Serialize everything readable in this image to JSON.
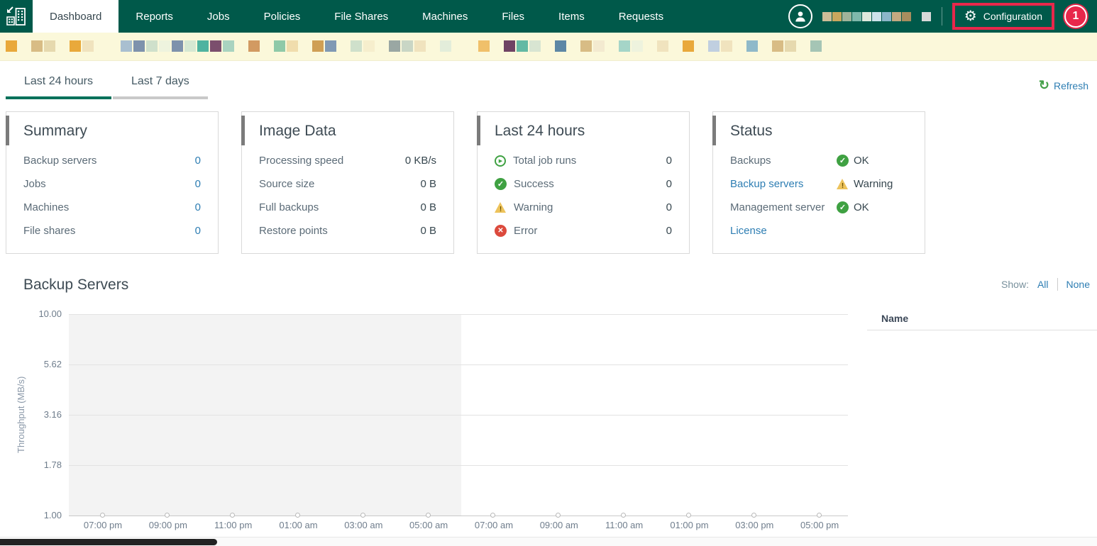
{
  "app": {
    "nav_tabs": [
      {
        "label": "Dashboard",
        "active": true
      },
      {
        "label": "Reports",
        "active": false
      },
      {
        "label": "Jobs",
        "active": false
      },
      {
        "label": "Policies",
        "active": false
      },
      {
        "label": "File Shares",
        "active": false
      },
      {
        "label": "Machines",
        "active": false
      },
      {
        "label": "Files",
        "active": false
      },
      {
        "label": "Items",
        "active": false
      },
      {
        "label": "Requests",
        "active": false
      }
    ],
    "configuration": {
      "label": "Configuration",
      "icon": "gear-icon",
      "highlighted": true
    },
    "notification_badge": "1",
    "user": {
      "icon": "person-avatar-icon",
      "redacted_colors": [
        "#cdbd98",
        "#c9a75e",
        "#9fb39a",
        "#7fb8ab",
        "#dfe8dd",
        "#cde2ea",
        "#8cb6c9",
        "#c3a981",
        "#a78d5e",
        "",
        "#d9d9d9"
      ]
    }
  },
  "redacted_strip": {
    "background": "#fbf8da",
    "squares": [
      "#e9a93b",
      "",
      "#d8bc85",
      "#e6d9ae",
      "",
      "#e9a93b",
      "#f0e3be",
      "",
      "",
      "#a9bfd0",
      "#7e92ac",
      "#cfe0cb",
      "#eef3de",
      "#7e92ac",
      "#d6e8d2",
      "#4fb3a0",
      "#7b4e6d",
      "#a9d3c0",
      "",
      "#d29a62",
      "",
      "#8fc9a8",
      "#f0ddad",
      "",
      "#cf9f55",
      "#8099b4",
      "",
      "#cfe0cb",
      "#f6eecd",
      "",
      "#9aa7a3",
      "#c9d6c5",
      "#f0e3be",
      "",
      "#e3edda",
      "",
      "",
      "#f0c06a",
      "",
      "#6f4364",
      "#63b9a4",
      "#d8e5d2",
      "",
      "#5d87a5",
      "",
      "#d8bc85",
      "#f3ead0",
      "",
      "#a5d5c8",
      "#eef3de",
      "",
      "#f0e3be",
      "",
      "#e9a93b",
      "",
      "#c0cfe0",
      "#f0e3be",
      "",
      "#8fb9c9",
      "",
      "#d8bc85",
      "#e6d9ae",
      "",
      "#a5c5b5"
    ]
  },
  "period_tabs": {
    "tabs": [
      "Last 24 hours",
      "Last 7 days"
    ],
    "active": "Last 24 hours",
    "refresh_label": "Refresh",
    "refresh_icon": "refresh-icon"
  },
  "cards": {
    "summary": {
      "title": "Summary",
      "rows": [
        {
          "label": "Backup servers",
          "value": "0"
        },
        {
          "label": "Jobs",
          "value": "0"
        },
        {
          "label": "Machines",
          "value": "0"
        },
        {
          "label": "File shares",
          "value": "0"
        }
      ]
    },
    "image_data": {
      "title": "Image Data",
      "rows": [
        {
          "label": "Processing speed",
          "value": "0 KB/s"
        },
        {
          "label": "Source size",
          "value": "0 B"
        },
        {
          "label": "Full backups",
          "value": "0 B"
        },
        {
          "label": "Restore points",
          "value": "0 B"
        }
      ]
    },
    "last_24_hours": {
      "title": "Last 24 hours",
      "rows": [
        {
          "icon": "play-circle-icon",
          "label": "Total job runs",
          "value": "0"
        },
        {
          "icon": "success-check-icon",
          "label": "Success",
          "value": "0"
        },
        {
          "icon": "warning-triangle-icon",
          "label": "Warning",
          "value": "0"
        },
        {
          "icon": "error-cross-icon",
          "label": "Error",
          "value": "0"
        }
      ]
    },
    "status": {
      "title": "Status",
      "rows": [
        {
          "label": "Backups",
          "link": false,
          "status_icon": "ok-check-icon",
          "status": "OK"
        },
        {
          "label": "Backup servers",
          "link": true,
          "status_icon": "warning-triangle-icon",
          "status": "Warning"
        },
        {
          "label": "Management server",
          "link": false,
          "status_icon": "ok-check-icon",
          "status": "OK"
        },
        {
          "label": "License",
          "link": true,
          "status_icon": "",
          "status": ""
        }
      ]
    }
  },
  "backup_servers_section": {
    "title": "Backup Servers",
    "show_label": "Show:",
    "show_all": "All",
    "show_none": "None",
    "legend_header": "Name"
  },
  "chart_data": {
    "type": "line",
    "title": "Backup Servers",
    "xlabel": "",
    "ylabel": "Throughput (MB/s)",
    "yscale": "log",
    "ylim": [
      1.0,
      10.0
    ],
    "grid": true,
    "legend_position": "right",
    "y_ticks": [
      "10.00",
      "5.62",
      "3.16",
      "1.78",
      "1.00"
    ],
    "y_ticks_values": [
      10.0,
      5.62,
      3.16,
      1.78,
      1.0
    ],
    "x_ticks": [
      "07:00 pm",
      "09:00 pm",
      "11:00 pm",
      "01:00 am",
      "03:00 am",
      "05:00 am",
      "07:00 am",
      "09:00 am",
      "11:00 am",
      "01:00 pm",
      "03:00 pm",
      "05:00 pm"
    ],
    "series": [],
    "shaded_past_region": {
      "from_tick_index": 0,
      "until_tick_index": 5.5,
      "color": "#f3f3f3"
    },
    "legend_entries": []
  },
  "colors": {
    "nav_green": "#00594a",
    "annotation_red": "#e8274b",
    "link_blue": "#2e7eb3",
    "success_green": "#3fa142",
    "warning_amber": "#edc35c",
    "error_red": "#dc4a3d",
    "active_tab_underline": "#00715a",
    "strip_background": "#fbf8da"
  }
}
